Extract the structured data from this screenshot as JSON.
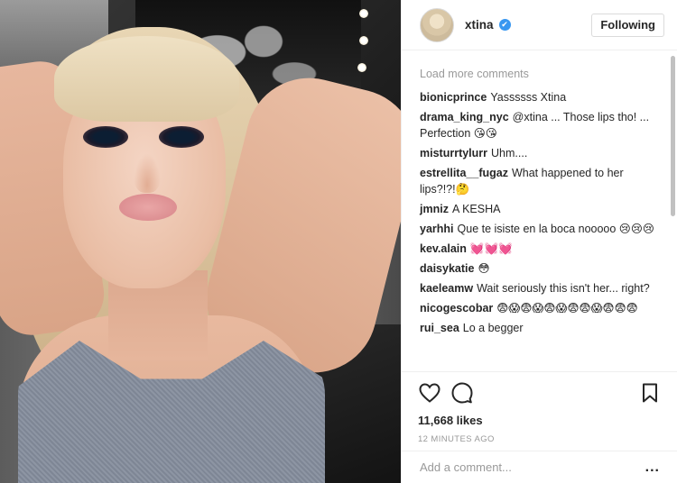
{
  "header": {
    "username": "xtina",
    "verified_icon": "✔",
    "follow_button": "Following"
  },
  "comments": {
    "load_more": "Load more comments",
    "items": [
      {
        "user": "bionicprince",
        "text": "Yassssss Xtina"
      },
      {
        "user": "drama_king_nyc",
        "text": "@xtina ... Those lips tho! ... Perfection 😘😘"
      },
      {
        "user": "misturrtylurr",
        "text": "Uhm...."
      },
      {
        "user": "estrellita__fugaz",
        "text": "What happened to her lips?!?!🤔"
      },
      {
        "user": "jmniz",
        "text": "A KESHA"
      },
      {
        "user": "yarhhi",
        "text": "Que te isiste en la boca nooooo 😢😢😢"
      },
      {
        "user": "kev.alain",
        "text": "💓💓💓"
      },
      {
        "user": "daisykatie",
        "text": "😳"
      },
      {
        "user": "kaeleamw",
        "text": "Wait seriously this isn't her... right?"
      },
      {
        "user": "nicogescobar",
        "text": "😨😱😨😱😨😱😨😨😱😨😨😨"
      },
      {
        "user": "rui_sea",
        "text": "Lo a begger"
      }
    ]
  },
  "actions": {
    "like_icon": "heart-outline",
    "comment_icon": "comment-bubble",
    "save_icon": "bookmark-outline",
    "likes": "11,668 likes",
    "time": "12 MINUTES AGO"
  },
  "add_comment": {
    "placeholder": "Add a comment...",
    "more": "..."
  },
  "colors": {
    "verified": "#3897f0",
    "muted_text": "#999999",
    "border": "#efefef"
  }
}
